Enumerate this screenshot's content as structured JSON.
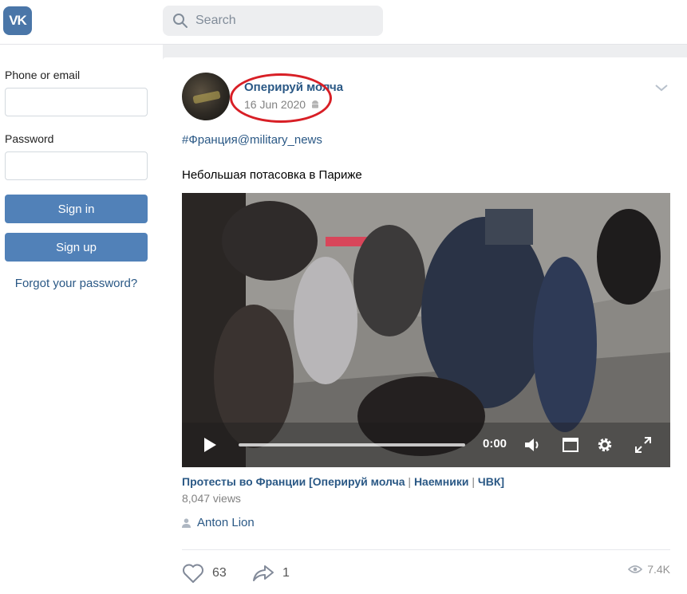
{
  "header": {
    "logo_text": "VK",
    "search_placeholder": "Search"
  },
  "login": {
    "phone_label": "Phone or email",
    "password_label": "Password",
    "signin_label": "Sign in",
    "signup_label": "Sign up",
    "forgot_label": "Forgot your password?"
  },
  "post": {
    "author": "Оперируй молча",
    "date": "16 Jun 2020",
    "hashtag": "#Франция@military_news",
    "text": "Небольшая потасовка в Париже",
    "video": {
      "time": "0:00",
      "title_part1": "Протесты во Франции [Оперируй молча",
      "title_sep1": " | ",
      "title_part2": "Наемники",
      "title_sep2": " | ",
      "title_part3": "ЧВК]",
      "views": "8,047 views",
      "author": "Anton Lion"
    },
    "likes": "63",
    "shares": "1",
    "seen": "7.4K"
  },
  "colors": {
    "brand": "#4a76a8",
    "button": "#5181b8",
    "link": "#2a5885",
    "highlight_circle": "#d81f26"
  },
  "icons": [
    "vk-logo",
    "search-icon",
    "android-icon",
    "chevron-down-icon",
    "play-icon",
    "volume-icon",
    "miniplayer-icon",
    "settings-gear-icon",
    "fullscreen-icon",
    "person-icon",
    "heart-icon",
    "share-arrow-icon",
    "eye-icon"
  ]
}
